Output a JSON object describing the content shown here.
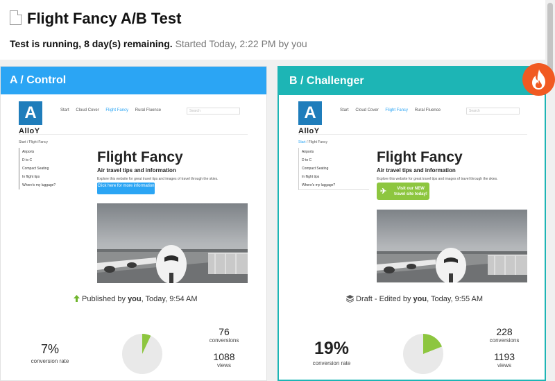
{
  "header": {
    "title": "Flight Fancy A/B Test",
    "status": "Test is running, 8 day(s) remaining.",
    "started": "Started Today, 2:22 PM by you"
  },
  "site": {
    "logo_letter": "A",
    "logo_text": "AlloY",
    "nav": [
      "Start",
      "Cloud Cover",
      "Flight Fancy",
      "Rural Fluence"
    ],
    "search_placeholder": "Search",
    "breadcrumb_home": "Start",
    "breadcrumb_sep": " / ",
    "breadcrumb_current": "Flight Fancy",
    "side_items": [
      "Airports",
      "D to C",
      "Compact Seating",
      "In flight tips",
      "Where's my luggage?"
    ],
    "title": "Flight Fancy",
    "subtitle": "Air travel tips and information",
    "description": "Explore this website for great travel tips and images of travel through the skies."
  },
  "variants": [
    {
      "name": "A / Control",
      "cta": "Click here for more information",
      "meta_prefix": "Published by",
      "meta_user": "you",
      "meta_suffix": ", Today, 9:54 AM",
      "rate": "7%",
      "rate_label": "conversion rate",
      "conversion_fraction": 0.07,
      "conversions": "76",
      "conversions_label": "conversions",
      "views": "1088",
      "views_label": "views"
    },
    {
      "name": "B / Challenger",
      "cta": "Visit our NEW travel site today!",
      "meta_prefix": "Draft - Edited by",
      "meta_user": "you",
      "meta_suffix": ", Today, 9:55 AM",
      "rate": "19%",
      "rate_label": "conversion rate",
      "conversion_fraction": 0.19,
      "conversions": "228",
      "conversions_label": "conversions",
      "views": "1193",
      "views_label": "views"
    }
  ],
  "icons": {
    "doc": "document-icon",
    "flame": "flame-icon",
    "published": "arrow-up-icon",
    "draft": "layers-icon"
  },
  "colors": {
    "control_accent": "#2ba5f4",
    "challenger_accent": "#1db5b5",
    "winner_badge": "#f15a22",
    "pie_fill": "#8dc63f",
    "pie_bg": "#e9e9e9",
    "cta_b": "#8dc63f"
  }
}
